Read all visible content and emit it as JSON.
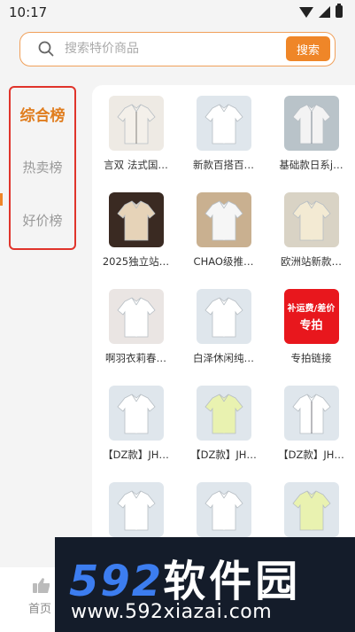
{
  "status": {
    "time": "10:17"
  },
  "search": {
    "placeholder": "搜索特价商品",
    "button": "搜索"
  },
  "sidebar": {
    "items": [
      {
        "label": "综合榜",
        "active": true
      },
      {
        "label": "热卖榜",
        "active": false
      },
      {
        "label": "好价榜",
        "active": false
      }
    ]
  },
  "products": [
    {
      "label": "言双 法式国…",
      "image": "shirt-outfit-photo"
    },
    {
      "label": "新款百搭百…",
      "image": "white-shirt-photo"
    },
    {
      "label": "基础款日系j…",
      "image": "group-shirts-photo"
    },
    {
      "label": "2025独立站…",
      "image": "silk-blouse-photo"
    },
    {
      "label": "CHAO级推…",
      "image": "folded-shirt-photo"
    },
    {
      "label": "欧洲站新款…",
      "image": "cream-blouse-photo"
    },
    {
      "label": "啊羽衣莉春…",
      "image": "ruffle-blouse-photo"
    },
    {
      "label": "白泽休闲纯…",
      "image": "white-shirt-photo"
    },
    {
      "label": "专拍链接",
      "image": "special-banner",
      "banner_line1": "补运费/差价",
      "banner_line2": "专拍"
    },
    {
      "label": "【DZ款】JH…",
      "image": "white-shirt-photo"
    },
    {
      "label": "【DZ款】JH…",
      "image": "lime-shirt-photo"
    },
    {
      "label": "【DZ款】JH…",
      "image": "striped-shirt-photo"
    },
    {
      "label": "",
      "image": "white-shirt-photo"
    },
    {
      "label": "",
      "image": "white-shirt-photo"
    },
    {
      "label": "",
      "image": "lime-shirt-photo"
    }
  ],
  "tabbar": {
    "home_label": "首页"
  },
  "watermark": {
    "logo_num": "592",
    "logo_cn": "软件园",
    "url": "www.592xiazai.com"
  },
  "colors": {
    "accent": "#ef8628",
    "highlight_border": "#e0342b",
    "banner_red": "#e8171d"
  }
}
